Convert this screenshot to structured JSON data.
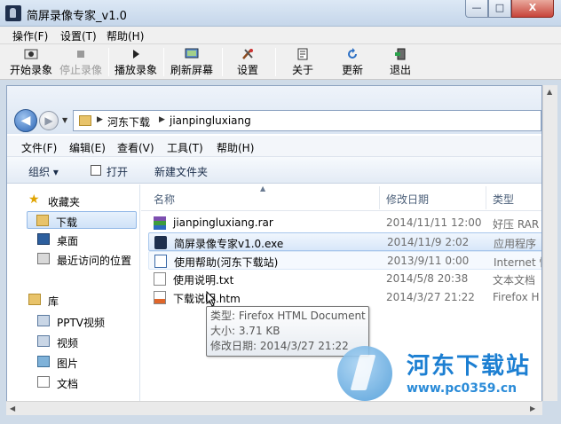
{
  "window": {
    "title": "简屏录像专家_v1.0",
    "min": "—",
    "max": "□",
    "close": "X"
  },
  "menubar": [
    "操作(F)",
    "设置(T)",
    "帮助(H)"
  ],
  "toolbar": {
    "start": "开始录象",
    "stop": "停止录像",
    "play": "播放录象",
    "refresh": "刷新屏幕",
    "settings": "设置",
    "about": "关于",
    "update": "更新",
    "exit": "退出"
  },
  "explorer": {
    "breadcrumb": [
      "河东下载",
      "jianpingluxiang"
    ],
    "menu": [
      "文件(F)",
      "编辑(E)",
      "查看(V)",
      "工具(T)",
      "帮助(H)"
    ],
    "commands": {
      "organize": "组织 ▾",
      "open": "打开",
      "new_folder": "新建文件夹"
    },
    "nav": {
      "favorites": "收藏夹",
      "downloads": "下载",
      "desktop": "桌面",
      "recent": "最近访问的位置",
      "libraries": "库",
      "pptv": "PPTV视频",
      "videos": "视频",
      "pictures": "图片",
      "documents": "文档"
    },
    "columns": {
      "name": "名称",
      "date": "修改日期",
      "type": "类型"
    },
    "files": [
      {
        "name": "jianpingluxiang.rar",
        "date": "2014/11/11 12:00",
        "type": "好压 RAR"
      },
      {
        "name": "简屏录像专家v1.0.exe",
        "date": "2014/11/9 2:02",
        "type": "应用程序"
      },
      {
        "name": "使用帮助(河东下载站)",
        "date": "2013/9/11 0:00",
        "type": "Internet 快"
      },
      {
        "name": "使用说明.txt",
        "date": "2014/5/8 20:38",
        "type": "文本文档"
      },
      {
        "name": "下载说明.htm",
        "date": "2014/3/27 21:22",
        "type": "Firefox H"
      }
    ],
    "tooltip": {
      "type": "类型: Firefox HTML Document",
      "size": "大小: 3.71 KB",
      "date": "修改日期: 2014/3/27 21:22"
    }
  },
  "watermark": {
    "brand": "河东下载站",
    "url": "www.pc0359.cn"
  }
}
